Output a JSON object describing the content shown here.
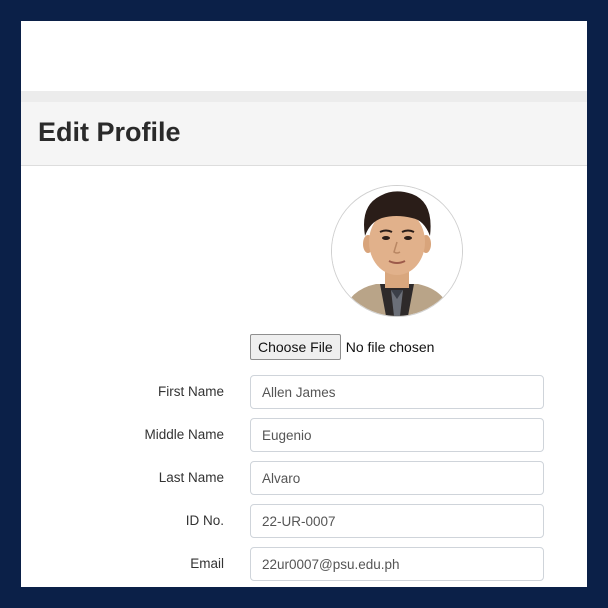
{
  "header": {
    "title": "Edit Profile"
  },
  "profile_photo": {
    "alt": "profile photo"
  },
  "file_upload": {
    "button_label": "Choose File",
    "status": "No file chosen"
  },
  "form": {
    "fields": [
      {
        "label": "First Name",
        "value": "Allen James"
      },
      {
        "label": "Middle Name",
        "value": "Eugenio"
      },
      {
        "label": "Last Name",
        "value": "Alvaro"
      },
      {
        "label": "ID No.",
        "value": "22-UR-0007"
      },
      {
        "label": "Email",
        "value": "22ur0007@psu.edu.ph"
      }
    ]
  },
  "colors": {
    "page_background": "#0b2048",
    "header_background": "#f5f5f5",
    "input_border": "#cfd4da"
  }
}
